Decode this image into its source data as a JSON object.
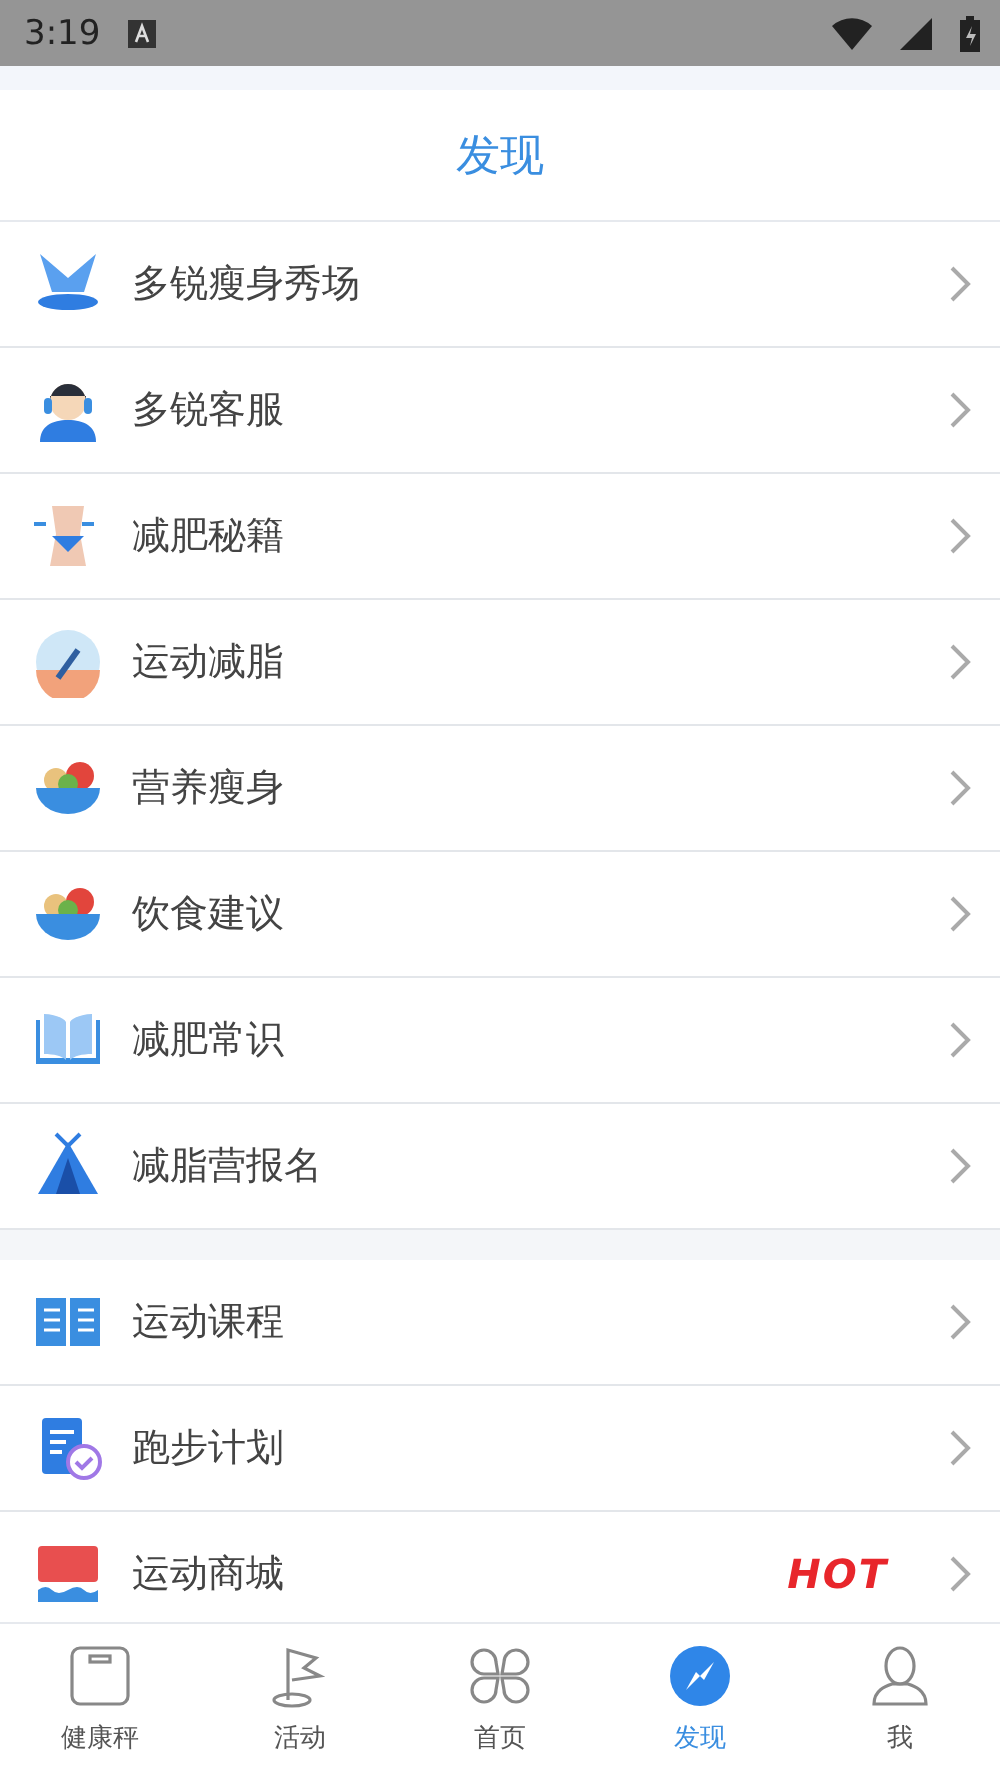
{
  "status_bar": {
    "time": "3:19"
  },
  "header": {
    "title": "发现"
  },
  "sections": [
    {
      "items": [
        {
          "label": "多锐瘦身秀场"
        },
        {
          "label": "多锐客服"
        },
        {
          "label": "减肥秘籍"
        },
        {
          "label": "运动减脂"
        },
        {
          "label": "营养瘦身"
        },
        {
          "label": "饮食建议"
        },
        {
          "label": "减肥常识"
        },
        {
          "label": "减脂营报名"
        }
      ]
    },
    {
      "items": [
        {
          "label": "运动课程"
        },
        {
          "label": "跑步计划"
        },
        {
          "label": "运动商城",
          "badge": "HOT"
        }
      ]
    }
  ],
  "tab_bar": [
    {
      "label": "健康秤",
      "selected": false
    },
    {
      "label": "活动",
      "selected": false
    },
    {
      "label": "首页",
      "selected": false
    },
    {
      "label": "发现",
      "selected": true
    },
    {
      "label": "我",
      "selected": false
    }
  ]
}
